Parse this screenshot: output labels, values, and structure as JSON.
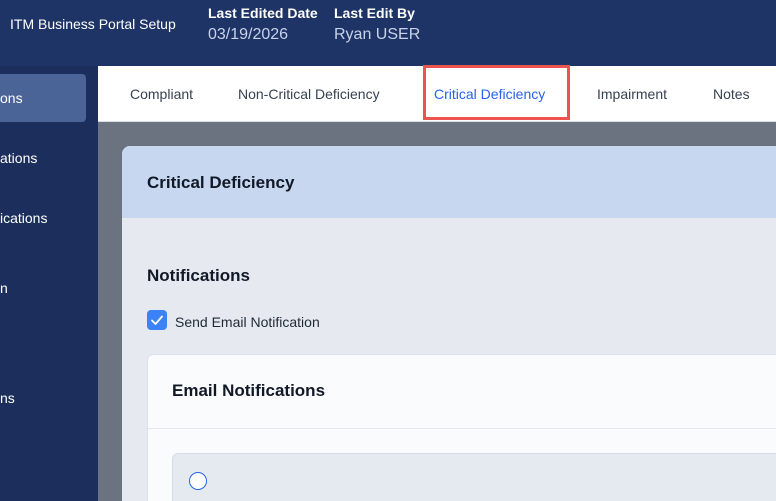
{
  "header": {
    "app_title": "ITM Business Portal Setup",
    "last_edited_date_label": "Last Edited Date",
    "last_edited_date_value": "03/19/2026",
    "last_edit_by_label": "Last Edit By",
    "last_edit_by_value": "Ryan USER"
  },
  "sidebar": {
    "items": [
      {
        "label": "ons",
        "active": true
      },
      {
        "label": "ations",
        "active": false
      },
      {
        "label": "ications",
        "active": false
      },
      {
        "label": "n",
        "active": false
      },
      {
        "label": "ns",
        "active": false
      }
    ]
  },
  "tabs": [
    {
      "label": "Compliant"
    },
    {
      "label": "Non-Critical Deficiency"
    },
    {
      "label": "Critical Deficiency",
      "active": true
    },
    {
      "label": "Impairment"
    },
    {
      "label": "Notes"
    }
  ],
  "card": {
    "title": "Critical Deficiency",
    "notifications_title": "Notifications",
    "send_email_label": "Send Email Notification",
    "send_email_checked": true,
    "email_section_title": "Email Notifications"
  },
  "colors": {
    "header_bg": "#1f3466",
    "sidebar_bg": "#1c2f5c",
    "active_tab": "#2563eb",
    "highlight": "#ef5350",
    "card_header_bg": "#c7d7ef"
  }
}
